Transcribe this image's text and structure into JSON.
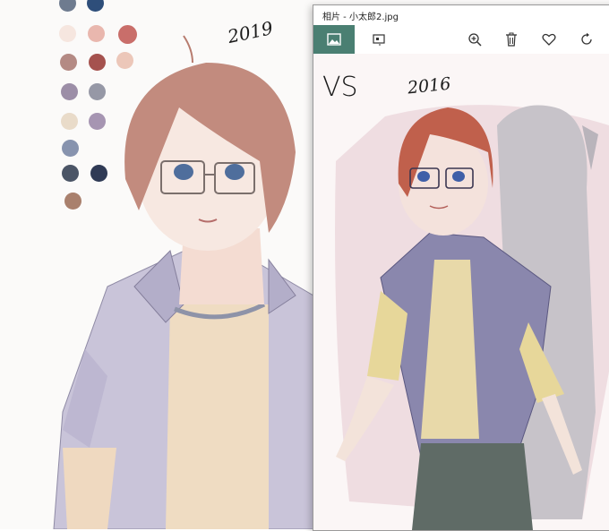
{
  "background": {
    "year_label_1": "2019",
    "palette": [
      "#6e7b8f",
      "#2e4e7a",
      "#f6e6df",
      "#e9b7ae",
      "#c96e6a",
      "#b48a84",
      "#a5524e",
      "#ecc7b9",
      "#9c8ea7",
      "#9698a6",
      "#e9dbc9",
      "#a695b2",
      "#8793ae",
      "#4b5566",
      "#2f3a55",
      "#a9806d"
    ]
  },
  "window": {
    "title": "相片 - 小太郎2.jpg",
    "toolbar": {
      "view_icon": "image-icon",
      "edit_icon": "slideshow-icon",
      "zoom_icon": "zoom-in-icon",
      "delete_icon": "trash-icon",
      "favorite_icon": "heart-icon",
      "rotate_icon": "rotate-icon"
    },
    "accent": "#4a7f72"
  },
  "viewer": {
    "vs_label": "VS",
    "year_label_2": "2016"
  }
}
